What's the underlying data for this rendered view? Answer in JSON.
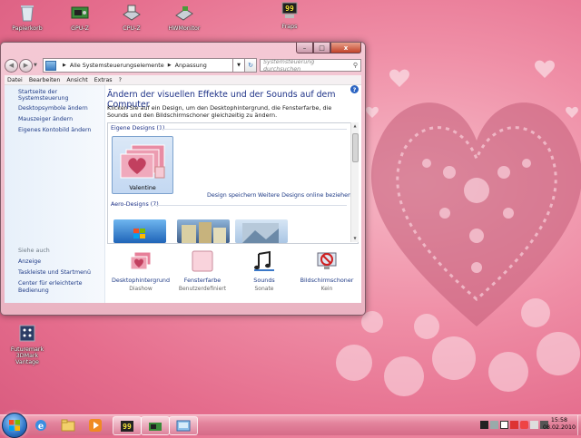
{
  "desktop": {
    "icons": [
      {
        "label": "Papierkorb",
        "icon": "recycle-bin-icon"
      },
      {
        "label": "GPU-Z",
        "icon": "gpu-z-icon"
      },
      {
        "label": "CPU-Z",
        "icon": "cpu-z-icon"
      },
      {
        "label": "HWMonitor",
        "icon": "hwmonitor-icon"
      },
      {
        "label": "Fraps",
        "icon": "fraps-icon"
      },
      {
        "label": "Futuremark 3DMark Vantage",
        "icon": "3dmark-icon"
      }
    ]
  },
  "window": {
    "title_buttons": {
      "minimize": "–",
      "maximize": "□",
      "close": "x"
    },
    "address": {
      "crumbs": [
        "Alle Systemsteuerungselemente",
        "Anpassung"
      ],
      "search_placeholder": "Systemsteuerung durchsuchen"
    },
    "menu": [
      "Datei",
      "Bearbeiten",
      "Ansicht",
      "Extras",
      "?"
    ],
    "left_pane": {
      "links": [
        "Startseite der Systemsteuerung",
        "Desktopsymbole ändern",
        "Mauszeiger ändern",
        "Eigenes Kontobild ändern"
      ],
      "see_also_header": "Siehe auch",
      "see_also": [
        "Anzeige",
        "Taskleiste und Startmenü",
        "Center für erleichterte Bedienung"
      ]
    },
    "main": {
      "title": "Ändern der visuellen Effekte und der Sounds auf dem Computer",
      "description": "Klicken Sie auf ein Design, um den Desktophintergrund, die Fensterfarbe, die Sounds und den Bildschirmschoner gleichzeitig zu ändern.",
      "my_themes_header": "Eigene Designs (1)",
      "selected_theme": "Valentine",
      "save_theme": "Design speichern",
      "more_themes": "Weitere Designs online beziehen",
      "aero_header": "Aero-Designs (7)",
      "bottom": [
        {
          "label": "Desktophintergrund",
          "sub": "Diashow"
        },
        {
          "label": "Fensterfarbe",
          "sub": "Benutzerdefiniert"
        },
        {
          "label": "Sounds",
          "sub": "Sonate"
        },
        {
          "label": "Bildschirmschoner",
          "sub": "Kein"
        }
      ]
    }
  },
  "taskbar": {
    "clock_time": "15:58",
    "clock_date": "08.02.2010"
  }
}
